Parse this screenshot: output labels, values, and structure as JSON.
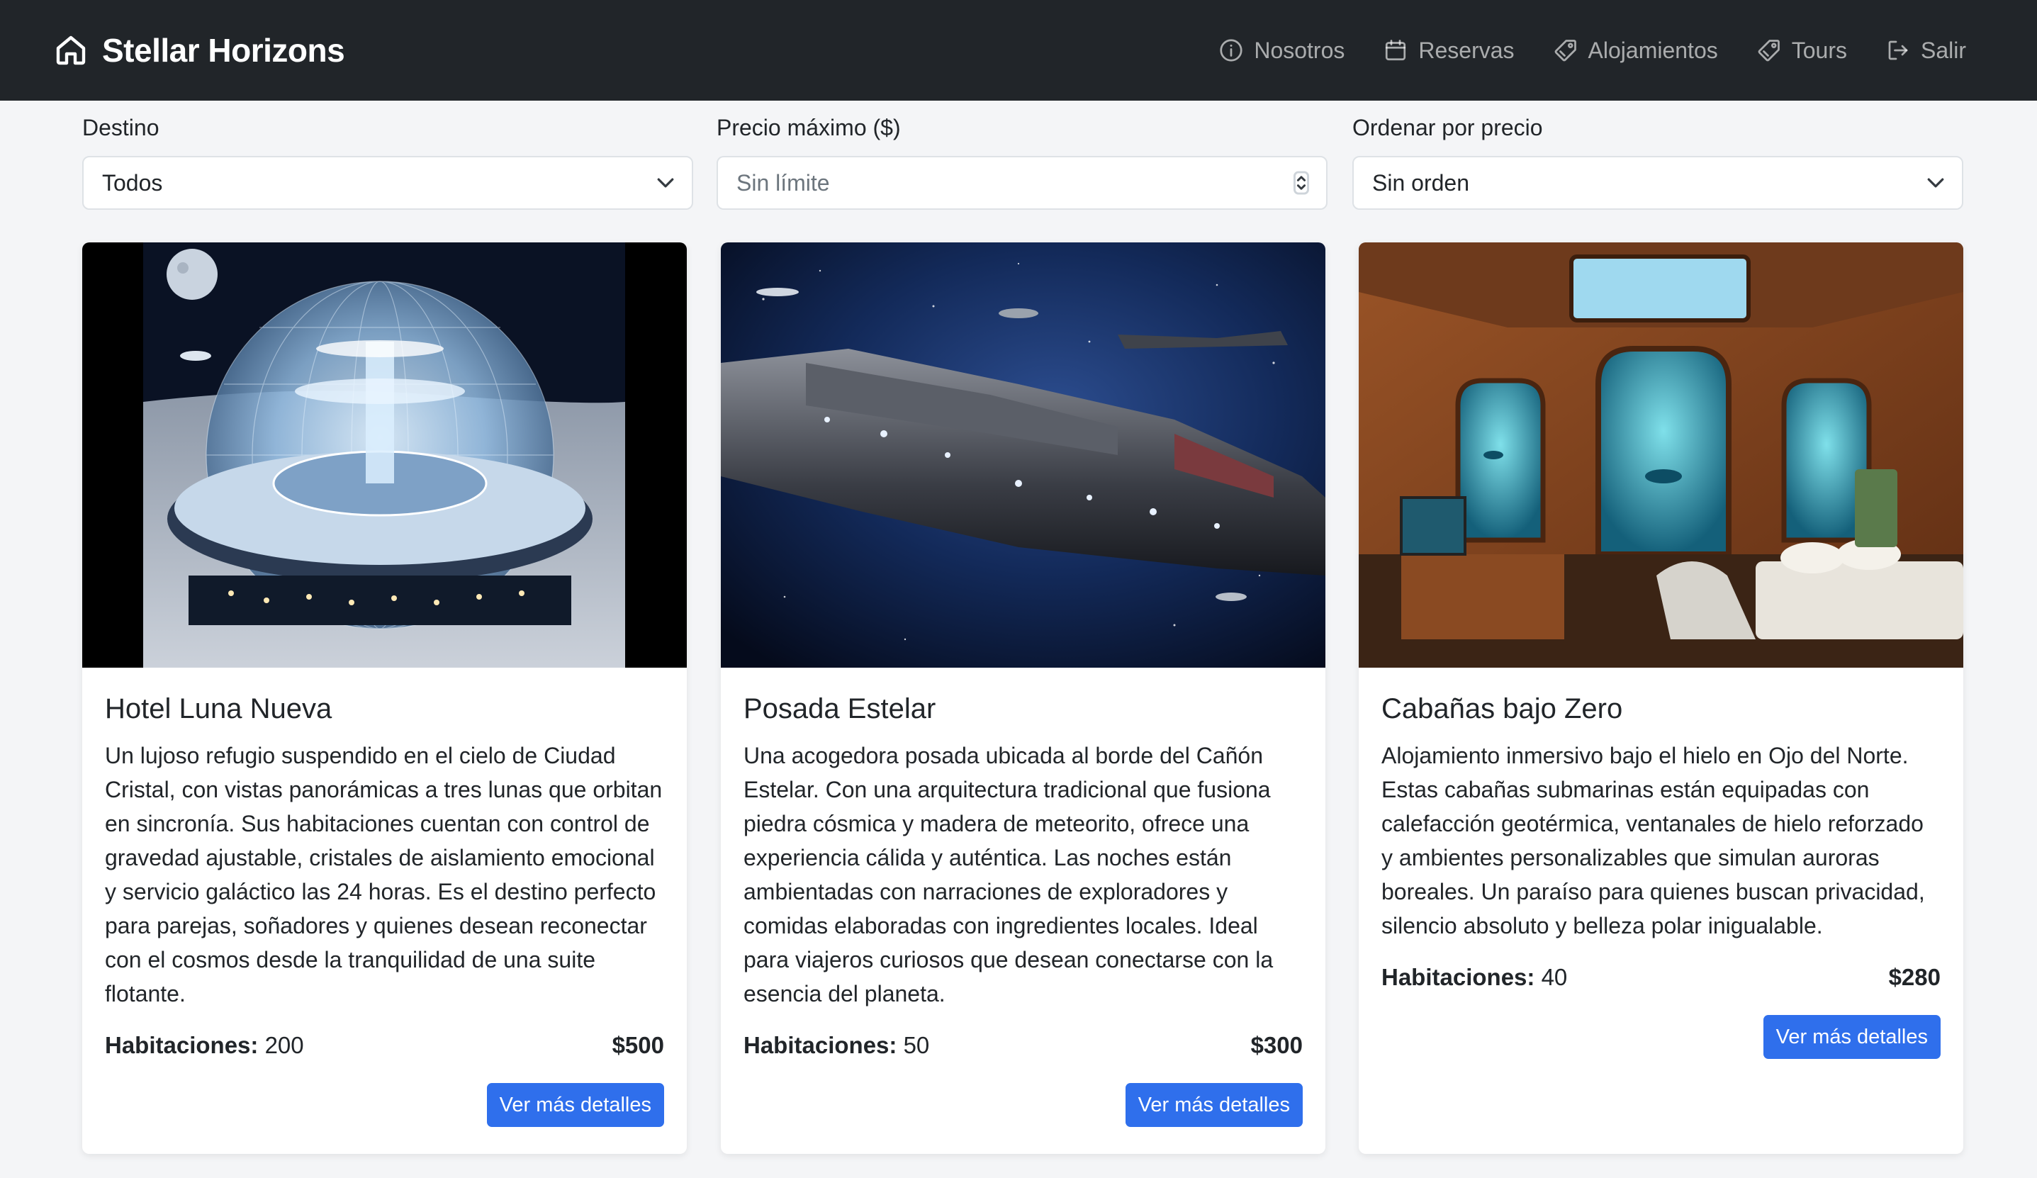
{
  "app": {
    "brand": "Stellar Horizons",
    "brand_icon": "home-icon"
  },
  "nav": {
    "items": [
      {
        "label": "Nosotros",
        "icon": "info-circle-icon"
      },
      {
        "label": "Reservas",
        "icon": "calendar-icon"
      },
      {
        "label": "Alojamientos",
        "icon": "tag-icon"
      },
      {
        "label": "Tours",
        "icon": "tag-icon"
      },
      {
        "label": "Salir",
        "icon": "logout-icon"
      }
    ]
  },
  "filters": {
    "destination": {
      "label": "Destino",
      "value": "Todos"
    },
    "max_price": {
      "label": "Precio máximo ($)",
      "placeholder": "Sin límite"
    },
    "order": {
      "label": "Ordenar por precio",
      "value": "Sin orden"
    }
  },
  "cards": [
    {
      "title": "Hotel Luna Nueva",
      "description": "Un lujoso refugio suspendido en el cielo de Ciudad Cristal, con vistas panorámicas a tres lunas que orbitan en sincronía. Sus habitaciones cuentan con control de gravedad ajustable, cristales de aislamiento emocional y servicio galáctico las 24 horas. Es el destino perfecto para parejas, soñadores y quienes desean reconectar con el cosmos desde la tranquilidad de una suite flotante.",
      "rooms_label": "Habitaciones:",
      "rooms": "200",
      "price": "$500",
      "button": "Ver más detalles"
    },
    {
      "title": "Posada Estelar",
      "description": "Una acogedora posada ubicada al borde del Cañón Estelar. Con una arquitectura tradicional que fusiona piedra cósmica y madera de meteorito, ofrece una experiencia cálida y auténtica. Las noches están ambientadas con narraciones de exploradores y comidas elaboradas con ingredientes locales. Ideal para viajeros curiosos que desean conectarse con la esencia del planeta.",
      "rooms_label": "Habitaciones:",
      "rooms": "50",
      "price": "$300",
      "button": "Ver más detalles"
    },
    {
      "title": "Cabañas bajo Zero",
      "description": "Alojamiento inmersivo bajo el hielo en Ojo del Norte. Estas cabañas submarinas están equipadas con calefacción geotérmica, ventanales de hielo reforzado y ambientes personalizables que simulan auroras boreales. Un paraíso para quienes buscan privacidad, silencio absoluto y belleza polar inigualable.",
      "rooms_label": "Habitaciones:",
      "rooms": "40",
      "price": "$280",
      "button": "Ver más detalles"
    }
  ],
  "colors": {
    "navbar": "#212529",
    "primary_button": "#2f6fec",
    "page_bg": "#f4f5f7"
  }
}
